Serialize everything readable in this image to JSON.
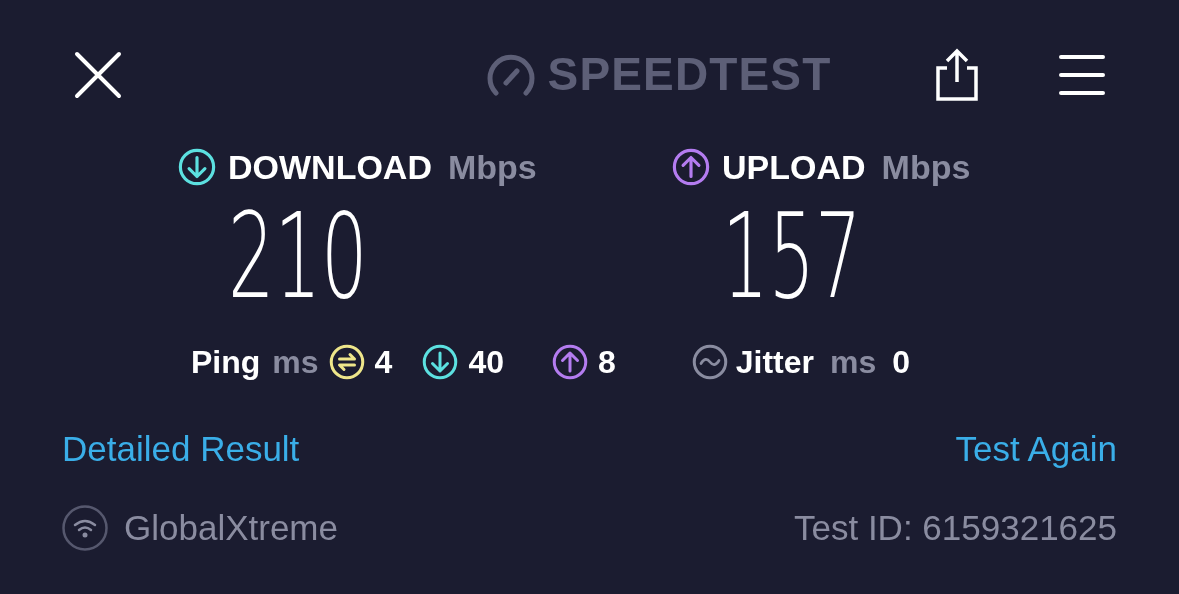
{
  "header": {
    "logo": "SPEEDTEST"
  },
  "results": [
    {
      "kind": "download",
      "label": "DOWNLOAD",
      "unit": "Mbps",
      "value": "210"
    },
    {
      "kind": "upload",
      "label": "UPLOAD",
      "unit": "Mbps",
      "value": "157"
    }
  ],
  "ping": {
    "label": "Ping",
    "unit": "ms",
    "stats": [
      {
        "kind": "idle",
        "value": "4"
      },
      {
        "kind": "download",
        "value": "40"
      },
      {
        "kind": "upload",
        "value": "8"
      }
    ]
  },
  "jitter": {
    "label": "Jitter",
    "unit": "ms",
    "value": "0"
  },
  "links": {
    "left": "Detailed Result",
    "right": "Test Again"
  },
  "footer": {
    "provider": "GlobalXtreme",
    "test_id": "Test ID: 6159321625"
  }
}
